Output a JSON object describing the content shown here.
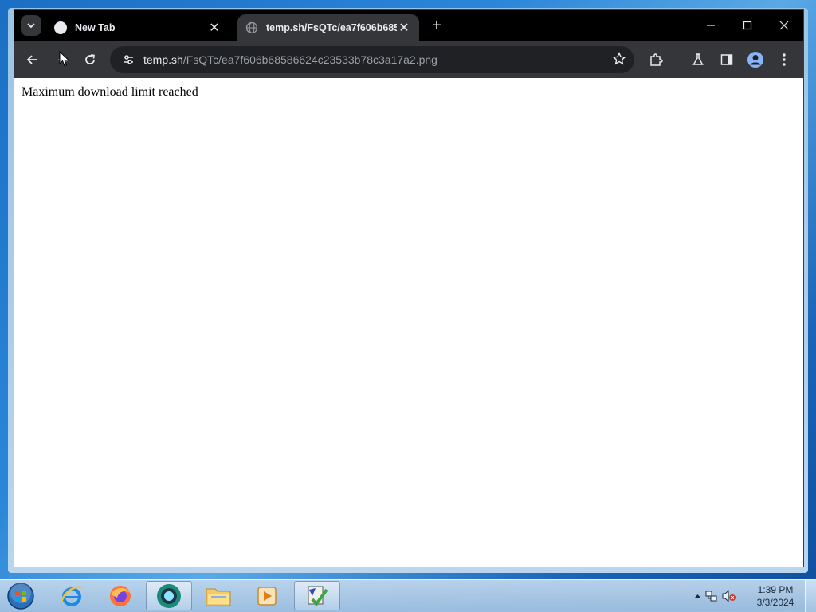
{
  "browser": {
    "tabs": [
      {
        "title": "New Tab",
        "active": false
      },
      {
        "title": "temp.sh/FsQTc/ea7f606b68586",
        "active": true
      }
    ],
    "address": {
      "host": "temp.sh",
      "path": "/FsQTc/ea7f606b68586624c23533b78c3a17a2.png"
    }
  },
  "page": {
    "message": "Maximum download limit reached"
  },
  "taskbar": {
    "clock": {
      "time": "1:39 PM",
      "date": "3/3/2024"
    }
  },
  "colors": {
    "tabbar_bg": "#000000",
    "toolbar_bg": "#35363a",
    "omnibox_bg": "#202124",
    "page_bg": "#ffffff"
  }
}
